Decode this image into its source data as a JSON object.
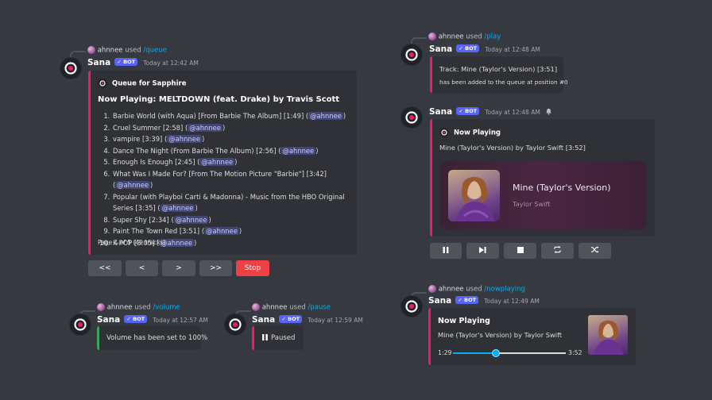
{
  "bot": {
    "name": "Sana",
    "badge": "✓ BOT"
  },
  "queue_msg": {
    "invoker": "ahnnee",
    "used_word": "used",
    "command": "/queue",
    "timestamp": "Today at 12:42 AM",
    "embed_author": "Queue for Sapphire",
    "now_playing": "Now Playing: MELTDOWN (feat. Drake) by Travis Scott",
    "tracks": [
      {
        "text": "Barbie World (with Aqua) [From Barbie The Album] [1:49]",
        "mention": "@ahnnee"
      },
      {
        "text": "Cruel Summer [2:58]",
        "mention": "@ahnnee"
      },
      {
        "text": "vampire [3:39]",
        "mention": "@ahnnee"
      },
      {
        "text": "Dance The Night (From Barbie The Album) [2:56]",
        "mention": "@ahnnee"
      },
      {
        "text": "Enough Is Enough [2:45]",
        "mention": "@ahnnee"
      },
      {
        "text": "What Was I Made For? [From The Motion Picture \"Barbie\"] [3:42]",
        "mention": "@ahnnee"
      },
      {
        "text": "Popular (with Playboi Carti & Madonna) - Music from the HBO Original Series [3:35]",
        "mention": "@ahnnee"
      },
      {
        "text": "Super Shy [2:34]",
        "mention": "@ahnnee"
      },
      {
        "text": "Paint The Town Red [3:51]",
        "mention": "@ahnnee"
      },
      {
        "text": "K-POP [3:05]",
        "mention": "@ahnnee"
      }
    ],
    "footer": "Page 1 of 5 (49 tracks)",
    "buttons": {
      "first": "<<",
      "prev": "<",
      "next": ">",
      "last": ">>",
      "stop": "Stop"
    }
  },
  "volume_msg": {
    "invoker": "ahnnee",
    "used_word": "used",
    "command": "/volume",
    "timestamp": "Today at 12:57 AM",
    "text": "Volume has been set to 100%"
  },
  "pause_msg": {
    "invoker": "ahnnee",
    "used_word": "used",
    "command": "/pause",
    "timestamp": "Today at 12:59 AM",
    "text": "Paused"
  },
  "play_msg": {
    "invoker": "ahnnee",
    "used_word": "used",
    "command": "/play",
    "timestamp": "Today at 12:48 AM",
    "line1": "Track: Mine (Taylor's Version) [3:51]",
    "line2": "has been added to the queue at position #0"
  },
  "nowplaying_card_msg": {
    "timestamp": "Today at 12:48 AM",
    "embed_author": "Now Playing",
    "description": "Mine (Taylor's Version) by Taylor Swift [3:52]",
    "card_title": "Mine (Taylor's Version)",
    "card_artist": "Taylor Swift"
  },
  "nowplaying_msg": {
    "invoker": "ahnnee",
    "used_word": "used",
    "command": "/nowplaying",
    "timestamp": "Today at 12:49 AM",
    "title": "Now Playing",
    "description": "Mine (Taylor's Version) by Taylor Swift",
    "elapsed": "1:29",
    "total": "3:52",
    "progress": 0.38
  },
  "colors": {
    "accent_pink": "#e91e63",
    "accent_green": "#3ba55c",
    "blurple": "#5865f2",
    "stop_red": "#ed4245"
  }
}
